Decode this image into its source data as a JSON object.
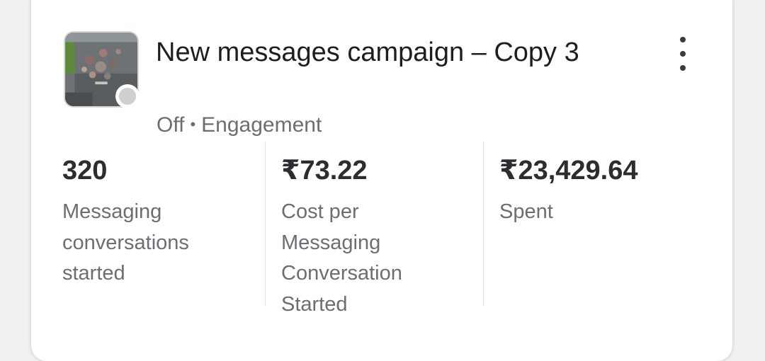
{
  "campaign": {
    "title": "New messages campaign – Copy 3",
    "status": "Off",
    "separator": "•",
    "objective": "Engagement",
    "thumbnail_icon": "campaign-thumbnail-image",
    "status_color": "#cfcfcf",
    "menu_icon": "more-vertical-icon"
  },
  "metrics": [
    {
      "value": "320",
      "label": "Messaging conversations started"
    },
    {
      "value": "₹73.22",
      "label": "Cost per Messaging Conversation Started"
    },
    {
      "value": "₹23,429.64",
      "label": "Spent"
    }
  ]
}
